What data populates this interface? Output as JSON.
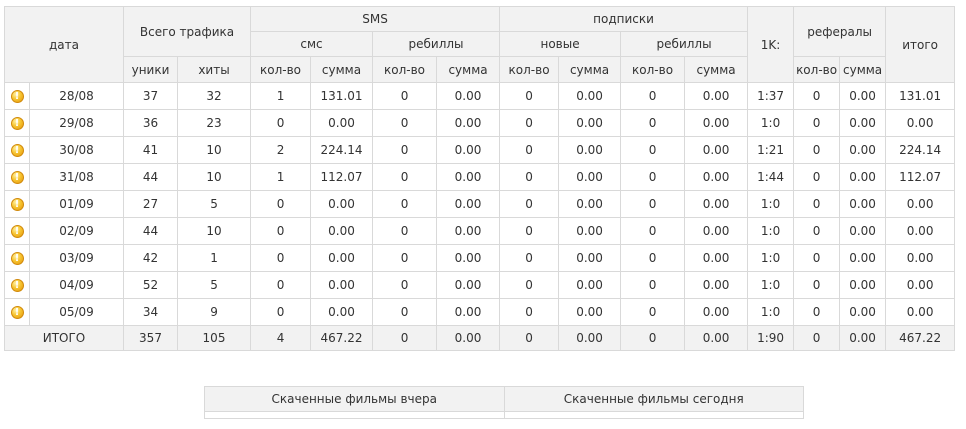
{
  "headers": {
    "date": "дата",
    "total_traffic": "Всего трафика",
    "sms": "SMS",
    "subscriptions": "подписки",
    "one_k": "1K:",
    "referrals": "рефералы",
    "total": "итого",
    "sms_sub": "смс",
    "rebills": "ребиллы",
    "new": "новые",
    "uniques": "уники",
    "hits": "хиты",
    "count": "кол-во",
    "sum": "сумма"
  },
  "rows": [
    [
      "28/08",
      "37",
      "32",
      "1",
      "131.01",
      "0",
      "0.00",
      "0",
      "0.00",
      "0",
      "0.00",
      "1:37",
      "0",
      "0.00",
      "131.01"
    ],
    [
      "29/08",
      "36",
      "23",
      "0",
      "0.00",
      "0",
      "0.00",
      "0",
      "0.00",
      "0",
      "0.00",
      "1:0",
      "0",
      "0.00",
      "0.00"
    ],
    [
      "30/08",
      "41",
      "10",
      "2",
      "224.14",
      "0",
      "0.00",
      "0",
      "0.00",
      "0",
      "0.00",
      "1:21",
      "0",
      "0.00",
      "224.14"
    ],
    [
      "31/08",
      "44",
      "10",
      "1",
      "112.07",
      "0",
      "0.00",
      "0",
      "0.00",
      "0",
      "0.00",
      "1:44",
      "0",
      "0.00",
      "112.07"
    ],
    [
      "01/09",
      "27",
      "5",
      "0",
      "0.00",
      "0",
      "0.00",
      "0",
      "0.00",
      "0",
      "0.00",
      "1:0",
      "0",
      "0.00",
      "0.00"
    ],
    [
      "02/09",
      "44",
      "10",
      "0",
      "0.00",
      "0",
      "0.00",
      "0",
      "0.00",
      "0",
      "0.00",
      "1:0",
      "0",
      "0.00",
      "0.00"
    ],
    [
      "03/09",
      "42",
      "1",
      "0",
      "0.00",
      "0",
      "0.00",
      "0",
      "0.00",
      "0",
      "0.00",
      "1:0",
      "0",
      "0.00",
      "0.00"
    ],
    [
      "04/09",
      "52",
      "5",
      "0",
      "0.00",
      "0",
      "0.00",
      "0",
      "0.00",
      "0",
      "0.00",
      "1:0",
      "0",
      "0.00",
      "0.00"
    ],
    [
      "05/09",
      "34",
      "9",
      "0",
      "0.00",
      "0",
      "0.00",
      "0",
      "0.00",
      "0",
      "0.00",
      "1:0",
      "0",
      "0.00",
      "0.00"
    ]
  ],
  "totals": [
    "ИТОГО",
    "357",
    "105",
    "4",
    "467.22",
    "0",
    "0.00",
    "0",
    "0.00",
    "0",
    "0.00",
    "1:90",
    "0",
    "0.00",
    "467.22"
  ],
  "info_icon_glyph": "!",
  "films": {
    "yesterday": "Скаченные фильмы вчера",
    "today": "Скаченные фильмы сегодня"
  }
}
